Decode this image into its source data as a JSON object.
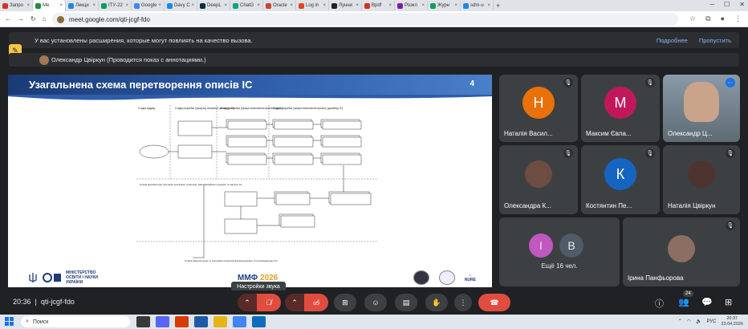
{
  "browser": {
    "tabs": [
      {
        "label": "Запро",
        "color": "#d93025"
      },
      {
        "label": "Me",
        "color": "#1e8e3e"
      },
      {
        "label": "Лекци",
        "color": "#1e88e5"
      },
      {
        "label": "ІТУ-22",
        "color": "#0f9d58"
      },
      {
        "label": "Google",
        "color": "#4285f4"
      },
      {
        "label": "Davy C",
        "color": "#1e88e5"
      },
      {
        "label": "DeepL",
        "color": "#0f2b46"
      },
      {
        "label": "ChatG",
        "color": "#10a37f"
      },
      {
        "label": "Oracle",
        "color": "#c74634"
      },
      {
        "label": "Log in",
        "color": "#e24329"
      },
      {
        "label": "Лунни",
        "color": "#222222"
      },
      {
        "label": "Bpdf",
        "color": "#d93025"
      },
      {
        "label": "Розкл",
        "color": "#7b1fa2"
      },
      {
        "label": "Журн",
        "color": "#0f9d58"
      },
      {
        "label": "sdm-u",
        "color": "#1e88e5"
      }
    ],
    "url": "meet.google.com/qti-jcgf-fdo"
  },
  "banner": {
    "text": "У вас установлены расширения, которые могут повлиять на качество вызова.",
    "details": "Подробнее",
    "skip": "Пропустить"
  },
  "presenter": {
    "text": "Олександр Цвіркун (Проводится показ с аннотациями.)"
  },
  "slide": {
    "title": "Узагальнена схема перетворення описів ІС",
    "number": "4",
    "ministry": "МІНІСТЕРСТВО ОСВІТИ І НАУКИ УКРАЇНИ",
    "event_prefix": "ММФ ",
    "event_year": "2026",
    "nure": "NURE",
    "diagram_labels": {
      "col1": "Стадія задуму",
      "col2": "Стадія розробки (процесу) концепції (вимог до ІС)",
      "col3": "Стадія розробки (процес визначення архітектури ІС)",
      "col4": "Стадія розробки (процес визначення проекту (дизайну) ІС)",
      "stage_impl": "Стадія виробництва (процесів реалізації, інтеграції, кваліфікаційних передачі та запуску ІС)",
      "stage_use": "Стадія використання та підтримки (процесів функціонування та супроводження ІС)"
    }
  },
  "tooltip": "Настройки звука",
  "participants": [
    {
      "initial": "Н",
      "name": "Наталія Васил...",
      "color": "#e8710a"
    },
    {
      "initial": "М",
      "name": "Максим Євла...",
      "color": "#c2185b"
    },
    {
      "initial": "",
      "name": "Олександр Ц...",
      "color": "#5f6368"
    },
    {
      "initial": "",
      "name": "Олександра К...",
      "color": "#6d4c41"
    },
    {
      "initial": "К",
      "name": "Костянтин Пе...",
      "color": "#1565c0"
    },
    {
      "initial": "",
      "name": "Наталія Цвіркун",
      "color": "#4e342e"
    },
    {
      "initial": "І",
      "name": "",
      "color": "#c058c0"
    },
    {
      "initial": "В",
      "name": "",
      "color": "#4f5b66"
    },
    {
      "initial": "",
      "name": "Ірина Панфьорова",
      "color": "#8d6e63"
    }
  ],
  "more_count": "Ещё 16 чел.",
  "meeting": {
    "time": "20:36",
    "code": "qti-jcgf-fdo",
    "people_count": "24"
  },
  "taskbar": {
    "search": "Поиск",
    "lang": "РУС",
    "time": "20:37",
    "date": "23.04.2026"
  }
}
